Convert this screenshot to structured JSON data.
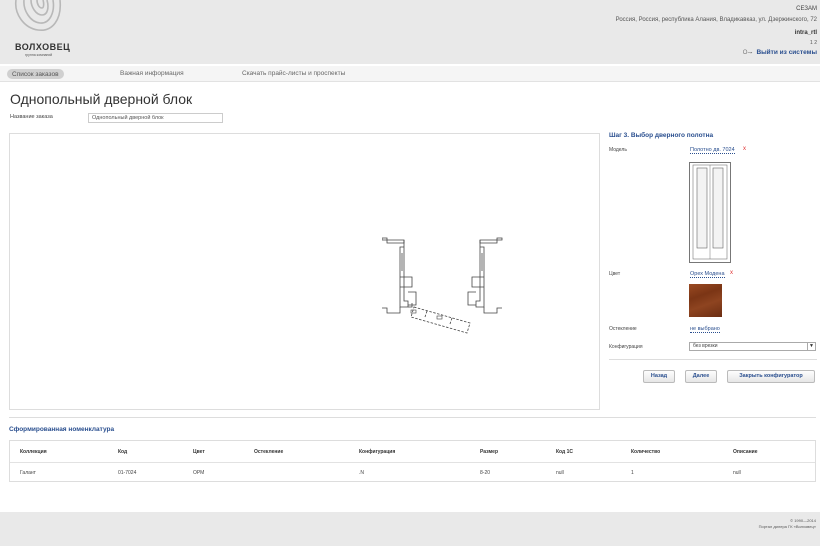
{
  "header": {
    "logo_title": "ВОЛХОВЕЦ",
    "logo_subtitle": "группа компаний",
    "company": "СЕЗАМ",
    "address": "Россия, Россия, республика Алания, Владикавказ, ул. Дзержинского, 72",
    "user_login": "intra_rtl",
    "user_sub": "1 2",
    "logout_label": "Выйти из системы",
    "key_icon": "key-icon"
  },
  "nav": {
    "items": [
      "Список заказов",
      "Важная информация",
      "Скачать прайс-листы и проспекты"
    ]
  },
  "page": {
    "title": "Однопольный дверной блок",
    "order_name_label": "Название заказа",
    "order_name_value": "Однопольный дверной блок"
  },
  "panel": {
    "step_title": "Шаг 3. Выбор дверного полотна",
    "model_label": "Модель",
    "model_value": "Полотно дв. 7024",
    "color_label": "Цвет",
    "color_value": "Орех Модена",
    "glazing_label": "Остекление",
    "glazing_value": "не выбрано",
    "config_label": "Конфигурация",
    "config_value": "без врезки",
    "remove_symbol": "x",
    "buttons": {
      "back": "Назад",
      "next": "Далее",
      "close": "Закрыть конфигуратор"
    },
    "swatch_color": "#7b3515"
  },
  "nomenclature": {
    "title": "Сформированная номенклатура",
    "columns": [
      "Коллекция",
      "Код",
      "Цвет",
      "Остекление",
      "Конфигурация",
      "Размер",
      "Код 1С",
      "Количество",
      "Описание"
    ],
    "rows": [
      [
        "Галант",
        "01-7024",
        "ОРМ",
        "",
        ".N",
        "8-20",
        "null",
        "1",
        "null"
      ]
    ]
  },
  "footer": {
    "copyright": "© 1990—2014",
    "portal": "Портал дилера ГК «Волховец»"
  }
}
